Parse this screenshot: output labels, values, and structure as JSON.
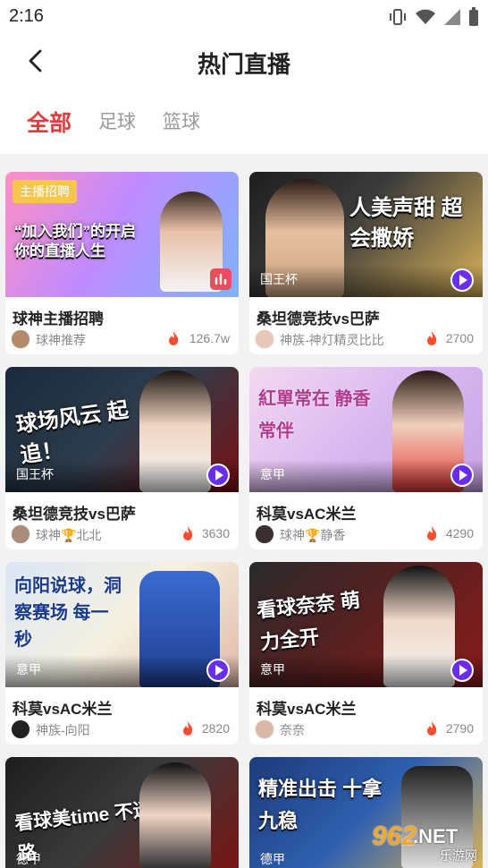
{
  "status_bar": {
    "time": "2:16"
  },
  "header": {
    "title": "热门直播"
  },
  "tabs": [
    {
      "label": "全部",
      "active": true
    },
    {
      "label": "足球",
      "active": false
    },
    {
      "label": "篮球",
      "active": false
    }
  ],
  "cards": [
    {
      "thumb_text": "“加入我们”的开启你的直播人生",
      "badge": "主播招聘",
      "league": "",
      "title": "球神主播招聘",
      "author": "球神推荐",
      "heat": "126.7w"
    },
    {
      "thumb_text": "人美声甜 超会撒娇",
      "badge": "",
      "league": "国王杯",
      "title": "桑坦德竞技vs巴萨",
      "author": "神族-神灯精灵比比",
      "heat": "2700"
    },
    {
      "thumb_text": "球场风云 起追！",
      "badge": "",
      "league": "国王杯",
      "title": "桑坦德竞技vs巴萨",
      "author": "球神🏆北北",
      "heat": "3630"
    },
    {
      "thumb_text": "紅單常在 静香常伴",
      "badge": "",
      "league": "意甲",
      "title": "科莫vsAC米兰",
      "author": "球神🏆静香",
      "heat": "4290"
    },
    {
      "thumb_text": "向阳说球，洞察赛场 每一秒",
      "badge": "",
      "league": "意甲",
      "title": "科莫vsAC米兰",
      "author": "神族-向阳",
      "heat": "2820"
    },
    {
      "thumb_text": "看球奈奈 萌力全开",
      "badge": "",
      "league": "意甲",
      "title": "科莫vsAC米兰",
      "author": "奈奈",
      "heat": "2790"
    },
    {
      "thumb_text": "看球美time 不迷路",
      "badge": "",
      "league": "德甲",
      "title": "",
      "author": "",
      "heat": ""
    },
    {
      "thumb_text": "精准出击 十拿九稳",
      "badge": "",
      "league": "德甲",
      "title": "",
      "author": "",
      "heat": ""
    }
  ],
  "watermark": {
    "number": "962",
    "suffix": ".NET",
    "site": "乐游网"
  },
  "colors": {
    "accent": "#e23b3b",
    "play": "#6a2cf0",
    "fire": "#ff4d2e"
  }
}
